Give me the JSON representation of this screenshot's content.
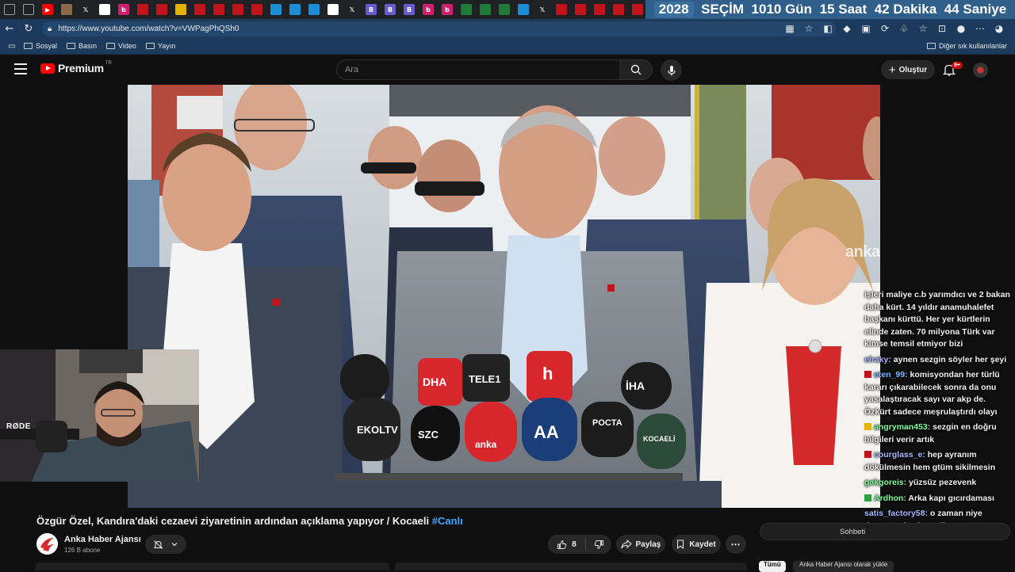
{
  "browser": {
    "countdown": {
      "year": "2028",
      "label": "SEÇİM",
      "days": "1010 Gün",
      "hours": "15 Saat",
      "minutes": "42 Dakika",
      "seconds": "44 Saniye"
    },
    "url": "https://www.youtube.com/watch?v=VWPagPhQSh0",
    "bookmarks": [
      "Sosyal",
      "Basın",
      "Video",
      "Yayın"
    ],
    "other_bookmarks": "Diğer sık kullanılanlar"
  },
  "youtube": {
    "logo_text": "Premium",
    "logo_region": "TR",
    "search_placeholder": "Ara",
    "create_label": "Oluştur",
    "notification_count": "9+",
    "video_watermark": "anka",
    "webcam_mic_label": "RØDE"
  },
  "video": {
    "title": "Özgür Özel, Kandıra'daki cezaevi ziyaretinin ardından açıklama yapıyor / Kocaeli",
    "hashtag": "#Canlı",
    "channel_name": "Anka Haber Ajansı",
    "subscribers": "126 B abone",
    "likes": "8",
    "share_label": "Paylaş",
    "save_label": "Kaydet"
  },
  "chat": {
    "toggle_label": "Sohbeti",
    "filter_all": "Tümü",
    "filter_channel": "Anka Haber Ajansı olarak yükle",
    "messages": [
      {
        "user": "",
        "text": "işleri maliye c.b yarımdıcı ve 2 bakan daha kürt. 14 yıldır anamuhalefet başkanı kürttü. Her yer kürtlerin elinde zaten. 70 milyona Türk var kimse temsil etmiyor bizi",
        "user_color": "#8fd3ff"
      },
      {
        "user": "elraky:",
        "text": "aynen sezgin söyler her şeyi",
        "user_color": "#a9b6ff"
      },
      {
        "user": "eten_99:",
        "text": "komisyondan her türlü kararı çıkarabilecek sonra da onu yasalaştıracak sayı var akp de. Özkürt sadece meşrulaştırdı olayı",
        "user_color": "#7db7ff"
      },
      {
        "user": "angryman453:",
        "text": "sezgin en doğru bilgileri verir artık",
        "user_color": "#7cff9a"
      },
      {
        "user": "courglass_e:",
        "text": "hep ayranım dökülmesin hem gtüm sikilmesin",
        "user_color": "#a9b6ff"
      },
      {
        "user": "gakgoreis:",
        "text": "yüzsüz pezevenk",
        "user_color": "#7cff9a"
      },
      {
        "user": "Ardhon:",
        "text": "Arka kapı gıcırdaması",
        "user_color": "#7cff9a"
      },
      {
        "user": "satis_factory58:",
        "text": "o zaman niye düzgün adamlar yollamıyorsun",
        "user_color": "#a9b6ff"
      }
    ]
  },
  "colors": {
    "yt_red": "#ff0000",
    "countdown_bg": "#2f5f8a",
    "link_blue": "#3ea6ff"
  }
}
